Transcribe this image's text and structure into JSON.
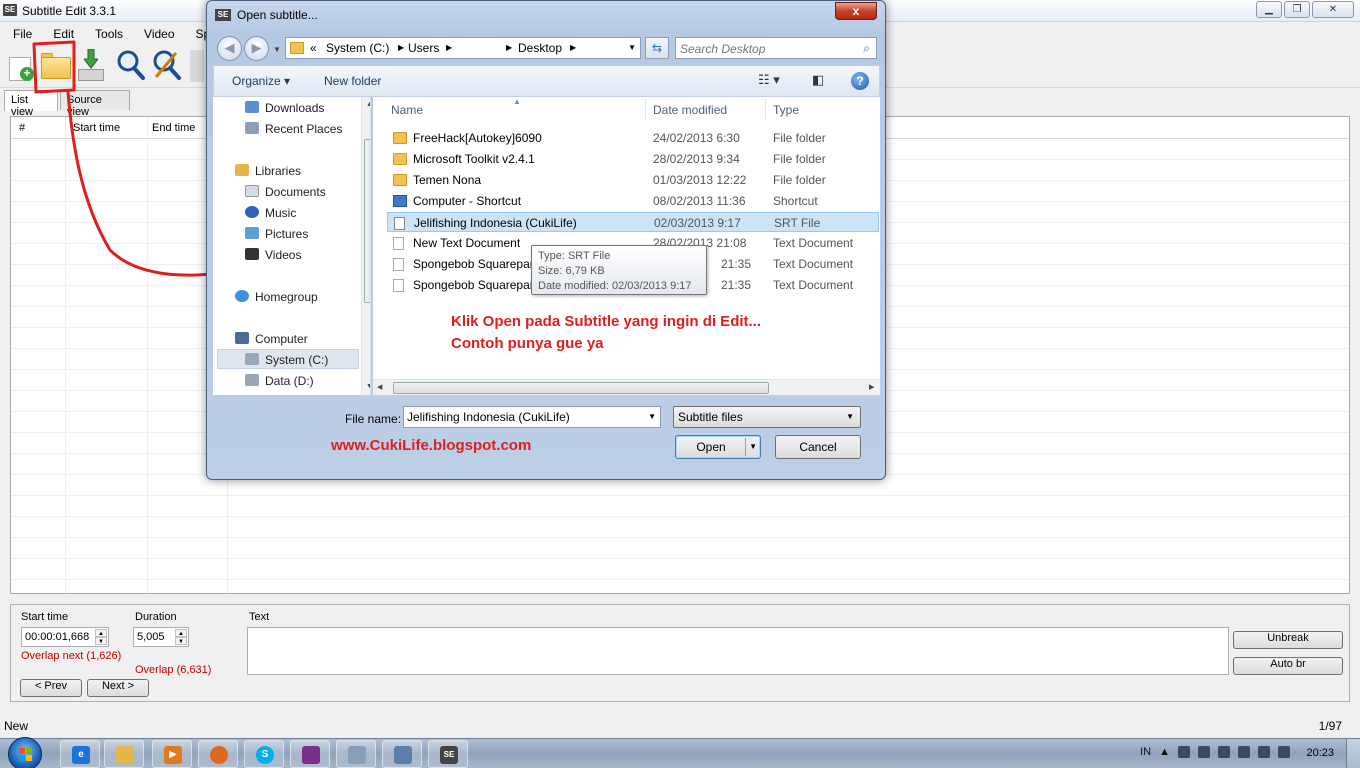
{
  "app": {
    "title": "Subtitle Edit 3.3.1",
    "logo": "SE",
    "menu": [
      "File",
      "Edit",
      "Tools",
      "Video",
      "Spe"
    ],
    "tabs": {
      "list_view": "List view",
      "source_view": "Source view"
    },
    "grid_headers": {
      "number": "#",
      "start_time": "Start time",
      "end_time": "End time"
    },
    "edit": {
      "start_time_label": "Start time",
      "start_time_value": "00:00:01,668",
      "duration_label": "Duration",
      "duration_value": "5,005",
      "text_label": "Text",
      "overlap_next": "Overlap next (1,626)",
      "overlap": "Overlap (6,631)",
      "prev_button": "< Prev",
      "next_button": "Next >",
      "unbreak_button": "Unbreak",
      "auto_br_button": "Auto br"
    },
    "status": {
      "left": "New",
      "right": "1/97"
    }
  },
  "dialog": {
    "title": "Open subtitle...",
    "logo": "SE",
    "close_label": "x",
    "breadcrumb": {
      "prefix": "«",
      "items": [
        "System (C:)",
        "Users",
        "Desktop"
      ]
    },
    "search_placeholder": "Search Desktop",
    "toolbar": {
      "organize": "Organize",
      "new_folder": "New folder"
    },
    "nav": {
      "downloads": "Downloads",
      "recent_places": "Recent Places",
      "libraries": "Libraries",
      "documents": "Documents",
      "music": "Music",
      "pictures": "Pictures",
      "videos": "Videos",
      "homegroup": "Homegroup",
      "computer": "Computer",
      "system_c": "System (C:)",
      "data_d": "Data (D:)"
    },
    "columns": {
      "name": "Name",
      "date_modified": "Date modified",
      "type": "Type"
    },
    "files": [
      {
        "name": "FreeHack[Autokey]6090",
        "date": "24/02/2013 6:30",
        "type": "File folder",
        "icon": "folder-icon"
      },
      {
        "name": "Microsoft Toolkit v2.4.1",
        "date": "28/02/2013 9:34",
        "type": "File folder",
        "icon": "folder-icon"
      },
      {
        "name": "Temen Nona",
        "date": "01/03/2013 12:22",
        "type": "File folder",
        "icon": "folder-icon"
      },
      {
        "name": "Computer - Shortcut",
        "date": "08/02/2013 11:36",
        "type": "Shortcut",
        "icon": "shortcut-icon"
      },
      {
        "name": "Jelifishing Indonesia (CukiLife)",
        "date": "02/03/2013 9:17",
        "type": "SRT File",
        "icon": "srt-file-icon"
      },
      {
        "name": "New Text Document",
        "date": "28/02/2013 21:08",
        "type": "Text Document",
        "icon": "text-document-icon"
      },
      {
        "name": "Spongebob Squarepan",
        "date": "21:35",
        "type": "Text Document",
        "icon": "text-document-icon"
      },
      {
        "name": "Spongebob Squarepan",
        "date": "21:35",
        "type": "Text Document",
        "icon": "text-document-icon"
      }
    ],
    "tooltip": {
      "type": "Type: SRT File",
      "size": "Size: 6,79 KB",
      "date": "Date modified: 02/03/2013 9:17"
    },
    "file_name_label": "File name:",
    "file_name_value": "Jelifishing Indonesia (CukiLife)",
    "file_type_value": "Subtitle files",
    "open_button": "Open",
    "cancel_button": "Cancel"
  },
  "annotations": {
    "line1": "Klik Open pada Subtitle yang ingin di Edit...",
    "line2": "Contoh punya gue ya",
    "website": "www.CukiLife.blogspot.com"
  },
  "taskbar": {
    "language": "IN",
    "clock": "20:23"
  },
  "colors": {
    "annotation_red": "#e01e1e",
    "overlap_red": "#c00000",
    "selection_blue": "#cce4f7"
  }
}
